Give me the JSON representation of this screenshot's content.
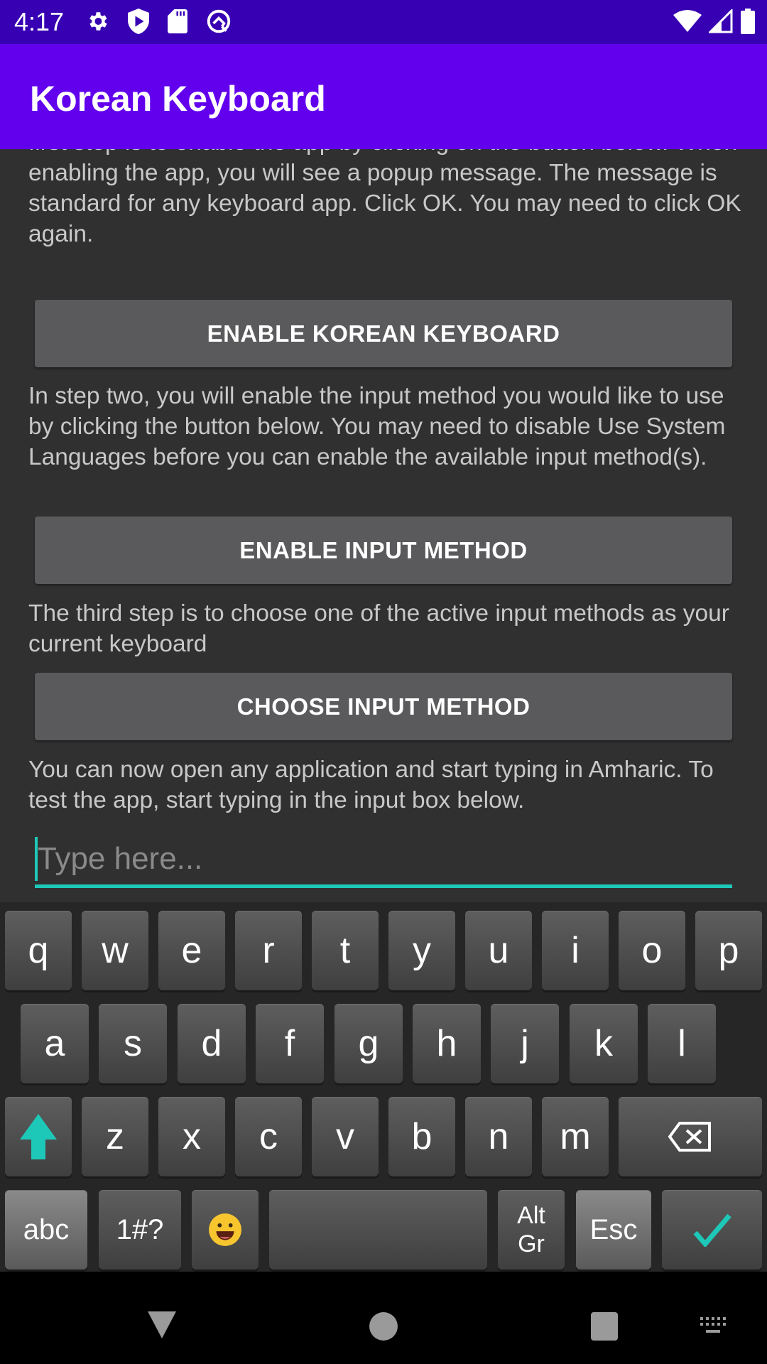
{
  "status_bar": {
    "time": "4:17",
    "left_icons": [
      "settings-gear",
      "play-protect-shield",
      "sd-card",
      "assistant-circle"
    ],
    "right_icons": [
      "wifi",
      "cell-signal",
      "battery"
    ]
  },
  "app_bar": {
    "title": "Korean Keyboard"
  },
  "content": {
    "para1": "Before you can use the app, you need to complete three steps. The first step is to enable the app by clicking on the button below. When enabling the app, you will see a popup message. The message is standard for any keyboard app. Click OK. You may need to click OK again.",
    "button1": "ENABLE KOREAN KEYBOARD",
    "para2": "In step two, you will enable the input method you would like to use by clicking the button below. You may need to disable Use System Languages before you can enable the available input method(s).",
    "button2": "ENABLE INPUT METHOD",
    "para3": "The third step is to choose one of the active input methods as your current keyboard",
    "button3": "CHOOSE INPUT METHOD",
    "para4": "You can now open any application and start typing in Amharic. To test the app, start typing in the input box below.",
    "input": {
      "value": "",
      "placeholder": "Type here..."
    }
  },
  "keyboard": {
    "row1": [
      "q",
      "w",
      "e",
      "r",
      "t",
      "y",
      "u",
      "i",
      "o",
      "p"
    ],
    "row2": [
      "a",
      "s",
      "d",
      "f",
      "g",
      "h",
      "j",
      "k",
      "l"
    ],
    "row3": [
      "z",
      "x",
      "c",
      "v",
      "b",
      "n",
      "m"
    ],
    "row4": {
      "abc": "abc",
      "symbols": "1#?",
      "emoji": "😀",
      "space": "",
      "altgr_1": "Alt",
      "altgr_2": "Gr",
      "esc": "Esc"
    },
    "accent_color": "#1ec8b8"
  },
  "nav_bar": {
    "buttons": [
      "back",
      "home",
      "recents",
      "keyboard-switcher"
    ]
  }
}
